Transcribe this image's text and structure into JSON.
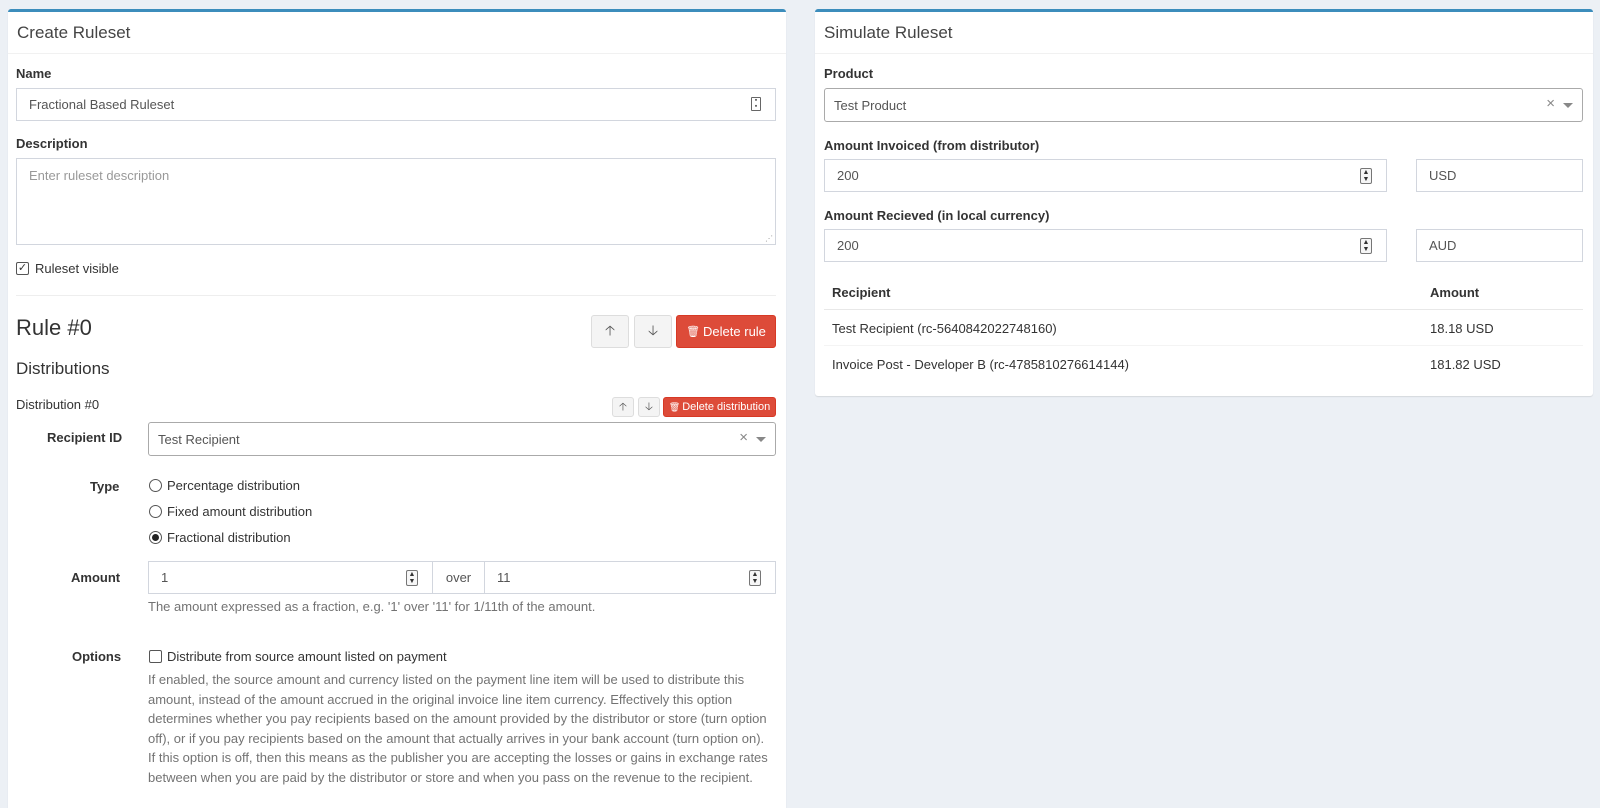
{
  "create": {
    "title": "Create Ruleset",
    "name_label": "Name",
    "name_value": "Fractional Based Ruleset",
    "description_label": "Description",
    "description_placeholder": "Enter ruleset description",
    "visible_label": "Ruleset visible",
    "visible_checked": true,
    "rule_title": "Rule #0",
    "delete_rule_label": "Delete rule",
    "distributions_title": "Distributions",
    "distribution_title": "Distribution #0",
    "delete_distribution_label": "Delete distribution",
    "recipient_label": "Recipient ID",
    "recipient_value": "Test Recipient",
    "type_label": "Type",
    "type_options": [
      {
        "label": "Percentage distribution",
        "checked": false
      },
      {
        "label": "Fixed amount distribution",
        "checked": false
      },
      {
        "label": "Fractional distribution",
        "checked": true
      }
    ],
    "amount_label": "Amount",
    "amount_numerator": "1",
    "amount_over": "over",
    "amount_denominator": "11",
    "amount_help": "The amount expressed as a fraction, e.g. '1' over '11' for 1/11th of the amount.",
    "options_label": "Options",
    "option_checkbox_label": "Distribute from source amount listed on payment",
    "option_checked": false,
    "option_help": "If enabled, the source amount and currency listed on the payment line item will be used to distribute this amount, instead of the amount accrued in the original invoice line item currency. Effectively this option determines whether you pay recipients based on the amount provided by the distributor or store (turn option off), or if you pay recipients based on the amount that actually arrives in your bank account (turn option on). If this option is off, then this means as the publisher you are accepting the losses or gains in exchange rates between when you are paid by the distributor or store and when you pass on the revenue to the recipient."
  },
  "simulate": {
    "title": "Simulate Ruleset",
    "product_label": "Product",
    "product_value": "Test Product",
    "invoiced_label": "Amount Invoiced (from distributor)",
    "invoiced_value": "200",
    "invoiced_currency": "USD",
    "received_label": "Amount Recieved (in local currency)",
    "received_value": "200",
    "received_currency": "AUD",
    "table": {
      "headers": [
        "Recipient",
        "Amount"
      ],
      "rows": [
        [
          "Test Recipient (rc-5640842022748160)",
          "18.18 USD"
        ],
        [
          "Invoice Post - Developer B (rc-4785810276614144)",
          "181.82 USD"
        ]
      ]
    }
  },
  "colors": {
    "accent": "#3c8dbc",
    "danger": "#dd4b39",
    "background": "#ecf0f5"
  }
}
